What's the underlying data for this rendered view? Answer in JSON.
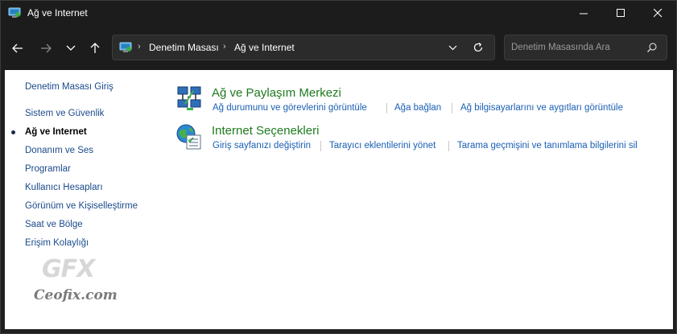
{
  "window": {
    "title": "Ağ ve Internet",
    "title_icon": "network-internet-icon"
  },
  "nav": {
    "back_icon": "arrow-left-icon",
    "forward_icon": "arrow-right-icon",
    "recent_icon": "chevron-down-icon",
    "up_icon": "arrow-up-icon"
  },
  "address": {
    "crumbs": [
      "Denetim Masası",
      "Ağ ve Internet"
    ],
    "separator": "›"
  },
  "search": {
    "placeholder": "Denetim Masasında Ara"
  },
  "sidebar": {
    "home": "Denetim Masası Giriş",
    "items": [
      "Sistem ve Güvenlik",
      "Ağ ve Internet",
      "Donanım ve Ses",
      "Programlar",
      "Kullanıcı Hesapları",
      "Görünüm ve Kişiselleştirme",
      "Saat ve Bölge",
      "Erişim Kolaylığı"
    ],
    "current_index": 1
  },
  "categories": [
    {
      "title": "Ağ ve Paylaşım Merkezi",
      "icon": "network-sharing-center-icon",
      "tasks": [
        "Ağ durumunu ve görevlerini görüntüle",
        "Ağa bağlan",
        "Ağ bilgisayarlarını ve aygıtları görüntüle"
      ]
    },
    {
      "title": "Internet Seçenekleri",
      "icon": "internet-options-icon",
      "tasks": [
        "Giriş sayfanızı değiştirin",
        "Tarayıcı eklentilerini yönet",
        "Tarama geçmişini ve tanımlama bilgilerini sil"
      ]
    }
  ],
  "watermark": {
    "logo": "GFX",
    "site": "Ceofix.com"
  },
  "colors": {
    "titlebar": "#1c1c1c",
    "category_title": "#1e7a1e",
    "link": "#1a5fb4"
  }
}
